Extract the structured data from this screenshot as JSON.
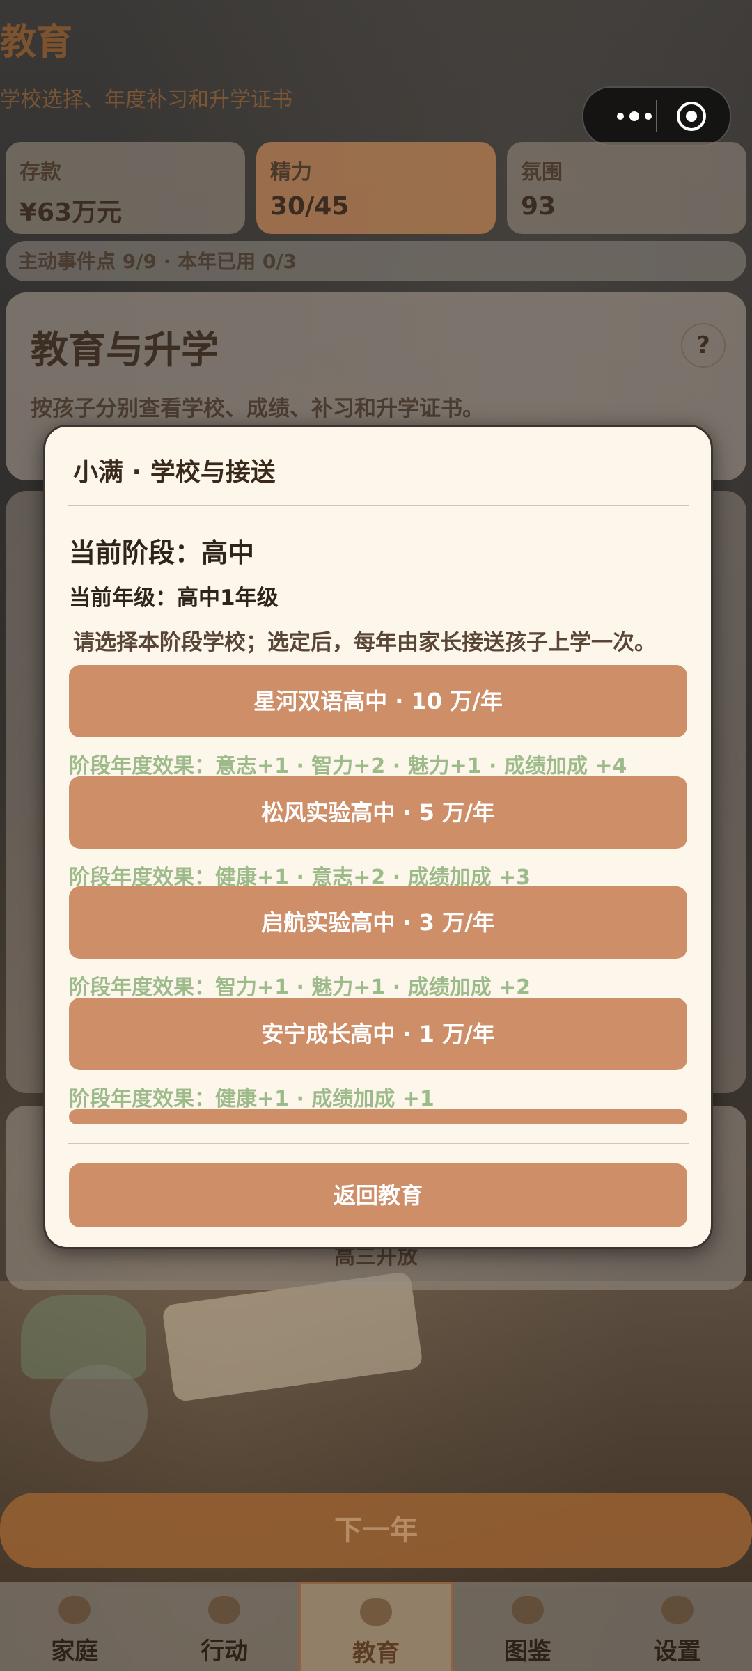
{
  "header": {
    "title": "教育",
    "subtitle": "学校选择、年度补习和升学证书"
  },
  "stats": [
    {
      "label": "存款",
      "value": "¥63万元"
    },
    {
      "label": "精力",
      "value": "30/45"
    },
    {
      "label": "氛围",
      "value": "93"
    }
  ],
  "event_points": "主动事件点 9/9 · 本年已用 0/3",
  "panel": {
    "title": "教育与升学",
    "description": "按孩子分别查看学校、成绩、补习和升学证书。",
    "help": "?"
  },
  "background_open_text": "高三开放",
  "next_year_label": "下一年",
  "nav": [
    {
      "label": "家庭",
      "icon": "family-icon"
    },
    {
      "label": "行动",
      "icon": "action-icon"
    },
    {
      "label": "教育",
      "icon": "book-icon"
    },
    {
      "label": "图鉴",
      "icon": "catalog-icon"
    },
    {
      "label": "设置",
      "icon": "settings-icon"
    }
  ],
  "modal": {
    "title": "小满 · 学校与接送",
    "stage": "当前阶段：高中",
    "grade": "当前年级：高中1年级",
    "description": "请选择本阶段学校；选定后，每年由家长接送孩子上学一次。",
    "schools": [
      {
        "label": "星河双语高中 · 10 万/年",
        "effect": "阶段年度效果：意志+1 · 智力+2 · 魅力+1 · 成绩加成 +4"
      },
      {
        "label": "松风实验高中 · 5 万/年",
        "effect": "阶段年度效果：健康+1 · 意志+2 · 成绩加成 +3"
      },
      {
        "label": "启航实验高中 · 3 万/年",
        "effect": "阶段年度效果：智力+1 · 魅力+1 · 成绩加成 +2"
      },
      {
        "label": "安宁成长高中 · 1 万/年",
        "effect": "阶段年度效果：健康+1 · 成绩加成 +1"
      }
    ],
    "return_label": "返回教育"
  },
  "colors": {
    "accent": "#cd8e68",
    "effect_text": "#9dba8a",
    "modal_bg": "#fdf6ea"
  }
}
